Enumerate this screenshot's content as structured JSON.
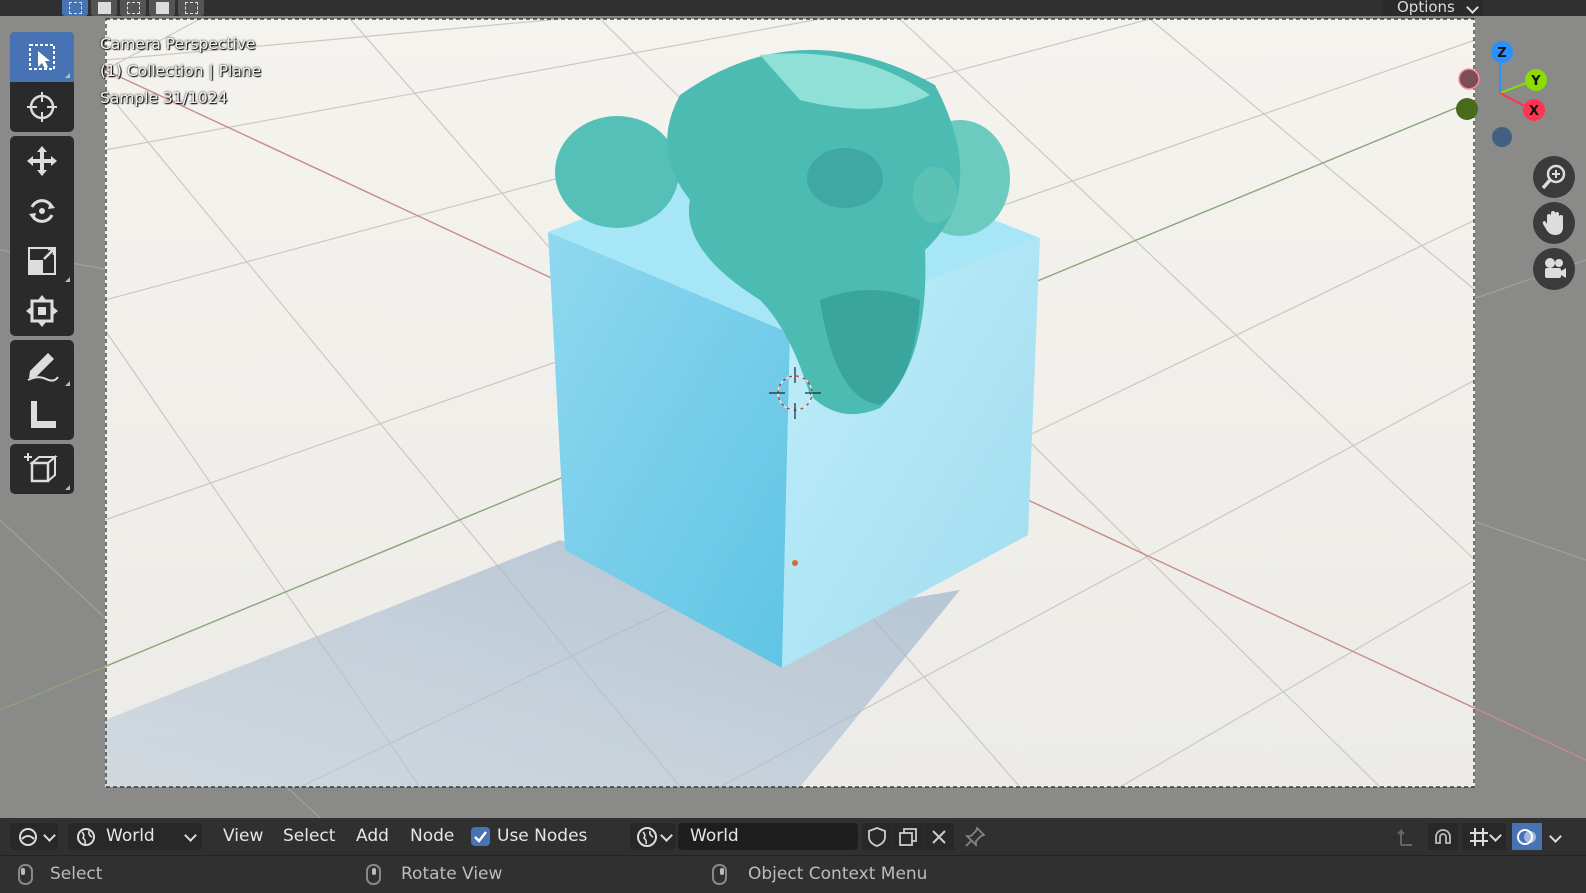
{
  "viewport": {
    "overlay": {
      "line1": "Camera Perspective",
      "line2": "(1) Collection | Plane",
      "line3": "Sample 31/1024"
    },
    "options_label": "Options",
    "gizmo": {
      "z": "Z",
      "y": "Y",
      "x": "X"
    },
    "selection_modes": [
      "select-box",
      "mode-new",
      "mode-extend",
      "mode-subtract",
      "mode-intersect"
    ],
    "tools": [
      "select-box",
      "cursor",
      "move",
      "rotate",
      "scale",
      "transform",
      "annotate",
      "measure",
      "add-cube"
    ],
    "nav": [
      "zoom-icon",
      "hand-pan-icon",
      "camera-view-icon"
    ]
  },
  "header": {
    "editor_type_icon": "shader-editor-icon",
    "shader_type": "World",
    "menus": {
      "view": "View",
      "select": "Select",
      "add": "Add",
      "node": "Node"
    },
    "use_nodes_label": "Use Nodes",
    "use_nodes_checked": true,
    "world_name": "World"
  },
  "statusbar": {
    "left": "Select",
    "middle": "Rotate View",
    "right": "Object Context Menu"
  },
  "colors": {
    "accent": "#4772b3",
    "axis_x": "#ff3352",
    "axis_y": "#8bdc00",
    "axis_z": "#2890ff"
  }
}
